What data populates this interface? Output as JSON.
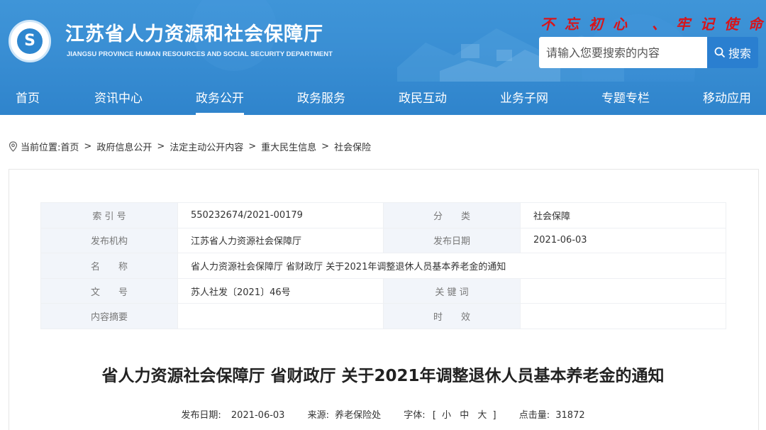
{
  "header": {
    "title": "江苏省人力资源和社会保障厅",
    "subtitle": "JIANGSU PROVINCE HUMAN RESOURCES AND SOCIAL SECURITY DEPARTMENT",
    "slogan": "不忘初心 、牢记使命",
    "search_placeholder": "请输入您要搜索的内容",
    "search_button": "搜索"
  },
  "nav": {
    "items": [
      {
        "label": "首页"
      },
      {
        "label": "资讯中心"
      },
      {
        "label": "政务公开"
      },
      {
        "label": "政务服务"
      },
      {
        "label": "政民互动"
      },
      {
        "label": "业务子网"
      },
      {
        "label": "专题专栏"
      },
      {
        "label": "移动应用"
      }
    ],
    "active_index": 2
  },
  "breadcrumb": {
    "prefix": "当前位置:",
    "items": [
      "首页",
      "政府信息公开",
      "法定主动公开内容",
      "重大民生信息",
      "社会保险"
    ],
    "separator": ">"
  },
  "info": {
    "index_label": "索 引 号",
    "index_value": "550232674/2021-00179",
    "category_label": "分　　类",
    "category_value": "社会保障",
    "publisher_label": "发布机构",
    "publisher_value": "江苏省人力资源社会保障厅",
    "date_label": "发布日期",
    "date_value": "2021-06-03",
    "name_label": "名　　称",
    "name_value": "省人力资源社会保障厅 省财政厅 关于2021年调整退休人员基本养老金的通知",
    "docno_label": "文　　号",
    "docno_value": "苏人社发〔2021〕46号",
    "keyword_label": "关 键 词",
    "keyword_value": "",
    "summary_label": "内容摘要",
    "summary_value": "",
    "validity_label": "时　　效",
    "validity_value": ""
  },
  "article": {
    "title": "省人力资源社会保障厅 省财政厅 关于2021年调整退休人员基本养老金的通知",
    "date_label": "发布日期:",
    "date_value": "2021-06-03",
    "source_label": "来源:",
    "source_value": "养老保险处",
    "font_label": "字体:",
    "font_open": "[",
    "font_small": "小",
    "font_medium": "中",
    "font_large": "大",
    "font_close": "]",
    "hits_label": "点击量:",
    "hits_value": "31872"
  },
  "colors": {
    "header_blue": "#3a8fd4",
    "slogan_red": "#d8141a",
    "search_button": "#2a7fd0",
    "table_label_bg": "#f2f5fa"
  }
}
